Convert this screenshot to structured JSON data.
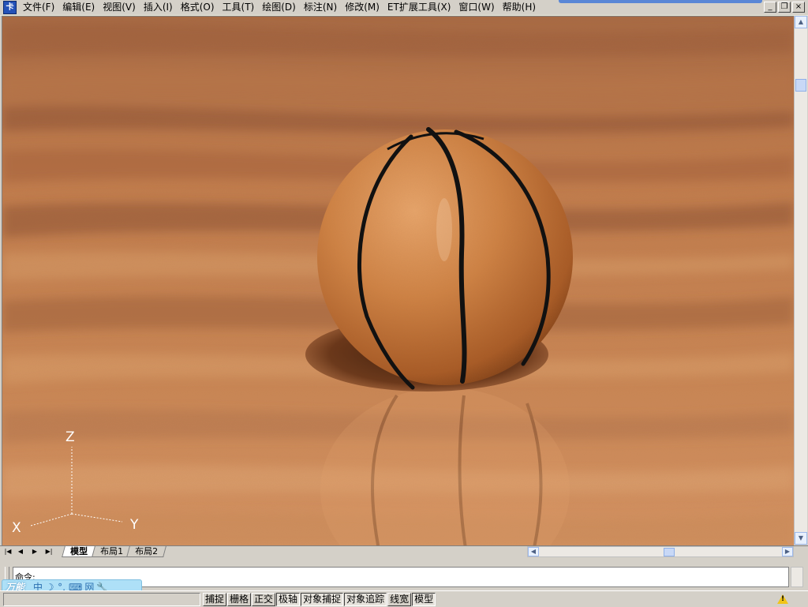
{
  "menubar": {
    "items": [
      {
        "label": "文件(F)"
      },
      {
        "label": "编辑(E)"
      },
      {
        "label": "视图(V)"
      },
      {
        "label": "插入(I)"
      },
      {
        "label": "格式(O)"
      },
      {
        "label": "工具(T)"
      },
      {
        "label": "绘图(D)"
      },
      {
        "label": "标注(N)"
      },
      {
        "label": "修改(M)"
      },
      {
        "label": "ET扩展工具(X)"
      },
      {
        "label": "窗口(W)"
      },
      {
        "label": "帮助(H)"
      }
    ],
    "window_buttons": {
      "minimize": "_",
      "restore": "❐",
      "close": "×"
    }
  },
  "viewport": {
    "ucs": {
      "x": "X",
      "y": "Y",
      "z": "Z"
    },
    "colors": {
      "floor": "#c47a44",
      "ball": "#c8773f",
      "seam": "#111111",
      "shadow": "#5a2a10"
    }
  },
  "layout_tabs": {
    "nav": [
      "|◀",
      "◀",
      "▶",
      "▶|"
    ],
    "tabs": [
      "模型",
      "布局1",
      "布局2"
    ],
    "active": "模型"
  },
  "command_line": {
    "text": "命令:"
  },
  "ime": {
    "logo": "万能",
    "buttons": [
      "中",
      "☽",
      "°,",
      "⌨",
      "网",
      "🔧"
    ]
  },
  "status_bar": {
    "toggles": [
      {
        "label": "捕捉",
        "on": false
      },
      {
        "label": "栅格",
        "on": false
      },
      {
        "label": "正交",
        "on": false
      },
      {
        "label": "极轴",
        "on": true
      },
      {
        "label": "对象捕捉",
        "on": true
      },
      {
        "label": "对象追踪",
        "on": true
      },
      {
        "label": "线宽",
        "on": false
      },
      {
        "label": "模型",
        "on": true
      }
    ]
  }
}
